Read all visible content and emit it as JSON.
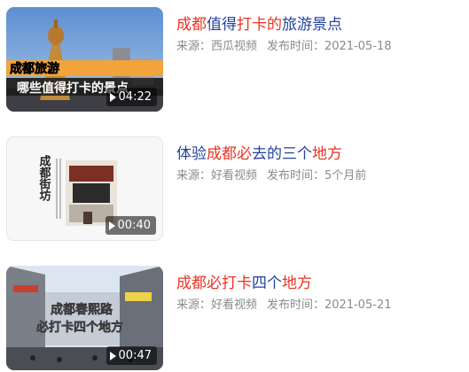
{
  "videos": [
    {
      "title_parts": [
        {
          "text": "成都",
          "hl": true
        },
        {
          "text": "值得",
          "hl": false
        },
        {
          "text": "打卡的",
          "hl": true
        },
        {
          "text": "旅游景点",
          "hl": false
        }
      ],
      "source": "来源：西瓜视频",
      "publish": "发布时间：2021-05-18",
      "duration": "04:22",
      "thumb_caption": [
        "成都旅游",
        "哪些值得打卡的景点"
      ]
    },
    {
      "title_parts": [
        {
          "text": "体验",
          "hl": false
        },
        {
          "text": "成都必",
          "hl": true
        },
        {
          "text": "去的三个",
          "hl": false
        },
        {
          "text": "地方",
          "hl": true
        }
      ],
      "source": "来源：好看视频",
      "publish": "发布时间：5个月前",
      "duration": "00:40",
      "thumb_caption": [
        "成都街坊"
      ]
    },
    {
      "title_parts": [
        {
          "text": "成都必打卡",
          "hl": true
        },
        {
          "text": "四个",
          "hl": false
        },
        {
          "text": "地方",
          "hl": true
        }
      ],
      "source": "来源：好看视频",
      "publish": "发布时间：2021-05-21",
      "duration": "00:47",
      "thumb_caption": [
        "成都春熙路",
        "必打卡四个地方"
      ]
    }
  ],
  "colors": {
    "title": "#2441a0",
    "highlight": "#ea3323",
    "meta": "#8a8a8a"
  },
  "icons": {
    "duration": "play-icon"
  }
}
